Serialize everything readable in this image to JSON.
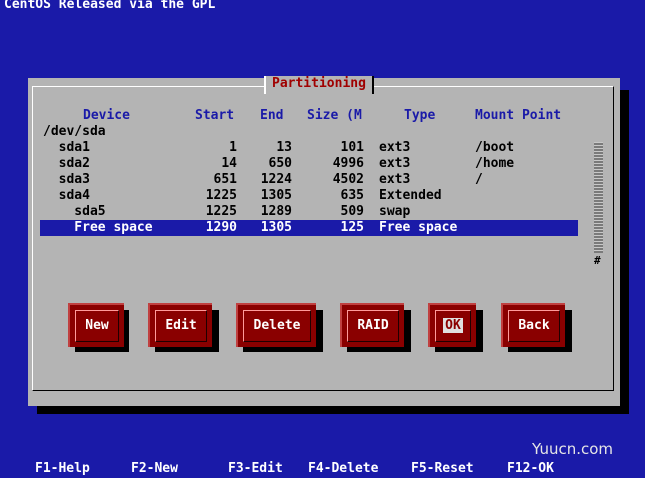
{
  "top_text": "CentOS Released via the GPL",
  "dialog": {
    "title": "Partitioning",
    "headers": {
      "device": "Device",
      "start": "Start",
      "end": "End",
      "size": "Size (M",
      "type": "Type",
      "mount": "Mount Point"
    },
    "rows": [
      {
        "device": "/dev/sda",
        "start": "",
        "end": "",
        "size": "",
        "type": "",
        "mount": ""
      },
      {
        "device": "  sda1",
        "start": "1",
        "end": "13",
        "size": "101",
        "type": "ext3",
        "mount": "/boot"
      },
      {
        "device": "  sda2",
        "start": "14",
        "end": "650",
        "size": "4996",
        "type": "ext3",
        "mount": "/home"
      },
      {
        "device": "  sda3",
        "start": "651",
        "end": "1224",
        "size": "4502",
        "type": "ext3",
        "mount": "/"
      },
      {
        "device": "  sda4",
        "start": "1225",
        "end": "1305",
        "size": "635",
        "type": "Extended",
        "mount": ""
      },
      {
        "device": "    sda5",
        "start": "1225",
        "end": "1289",
        "size": "509",
        "type": "swap",
        "mount": ""
      },
      {
        "device": "    Free space",
        "start": "1290",
        "end": "1305",
        "size": "125",
        "type": "Free space",
        "mount": ""
      }
    ],
    "selected_row": 6,
    "scroll_mark": "#",
    "buttons": {
      "new": "New",
      "edit": "Edit",
      "delete": "Delete",
      "raid": "RAID",
      "ok": "OK",
      "back": "Back"
    }
  },
  "function_keys": [
    "F1-Help",
    "F2-New",
    "F3-Edit",
    "F4-Delete",
    "F5-Reset",
    "F12-OK"
  ],
  "watermark": "Yuucn.com",
  "colors": {
    "background": "#1a1aa8",
    "panel": "#b4b4b4",
    "button": "#8a0000",
    "title": "#a00000"
  }
}
